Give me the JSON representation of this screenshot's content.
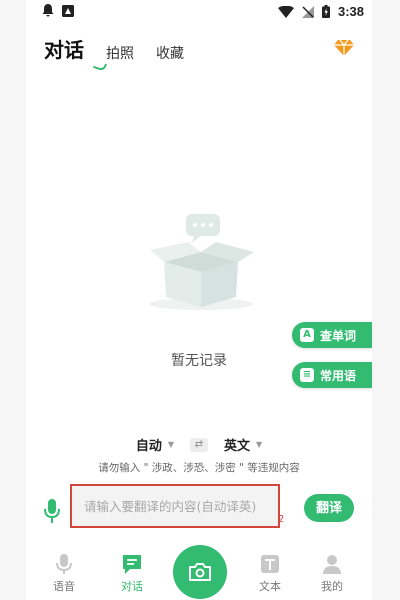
{
  "status_bar": {
    "time": "3:38"
  },
  "top_tabs": [
    {
      "label": "对话",
      "active": true
    },
    {
      "label": "拍照",
      "active": false
    },
    {
      "label": "收藏",
      "active": false
    }
  ],
  "empty_state": {
    "text": "暂无记录"
  },
  "floating_buttons": [
    {
      "label": "查单词",
      "icon": "dictionary-icon"
    },
    {
      "label": "常用语",
      "icon": "chat-bubble-icon"
    }
  ],
  "language": {
    "source": "自动",
    "target": "英文"
  },
  "warning_text": "请勿输入 \" 涉政、涉恐、涉密 \" 等违规内容",
  "input": {
    "placeholder": "请输入要翻译的内容(自动译英)",
    "value": ""
  },
  "annotation_mark": "2",
  "translate_button": "翻译",
  "bottom_nav": [
    {
      "label": "语音",
      "icon": "mic-icon"
    },
    {
      "label": "对话",
      "icon": "dialog-icon",
      "active": true
    },
    {
      "label": "",
      "icon": "camera-icon"
    },
    {
      "label": "文本",
      "icon": "text-icon"
    },
    {
      "label": "我的",
      "icon": "user-icon"
    }
  ],
  "colors": {
    "accent": "#33bb72",
    "highlight": "#d4463c",
    "vip": "#f39a1e"
  }
}
